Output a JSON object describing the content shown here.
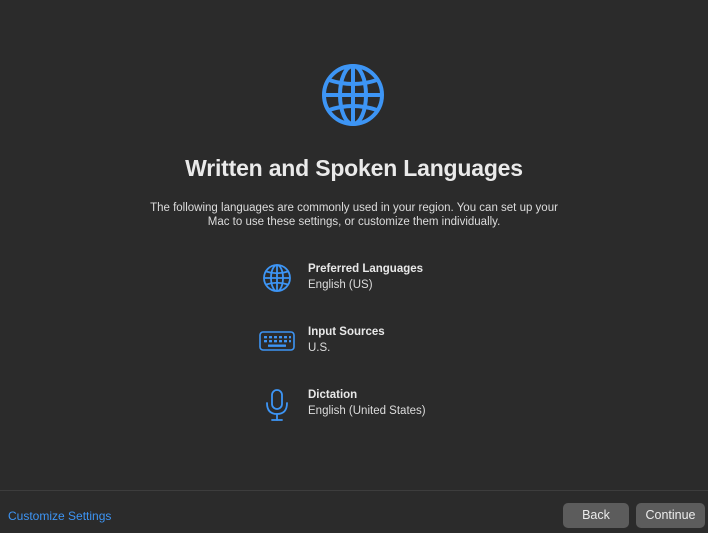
{
  "header": {
    "icon": "globe-icon",
    "title": "Written and Spoken Languages",
    "description": "The following languages are commonly used in your region. You can set up your Mac to use these settings, or customize them individually."
  },
  "settings": [
    {
      "icon": "globe-icon",
      "label": "Preferred Languages",
      "value": "English (US)"
    },
    {
      "icon": "keyboard-icon",
      "label": "Input Sources",
      "value": "U.S."
    },
    {
      "icon": "microphone-icon",
      "label": "Dictation",
      "value": "English (United States)"
    }
  ],
  "footer": {
    "customize_label": "Customize Settings",
    "back_label": "Back",
    "continue_label": "Continue"
  },
  "colors": {
    "background": "#2b2b2b",
    "accent": "#3d95f5",
    "button": "#5c5c5c"
  }
}
